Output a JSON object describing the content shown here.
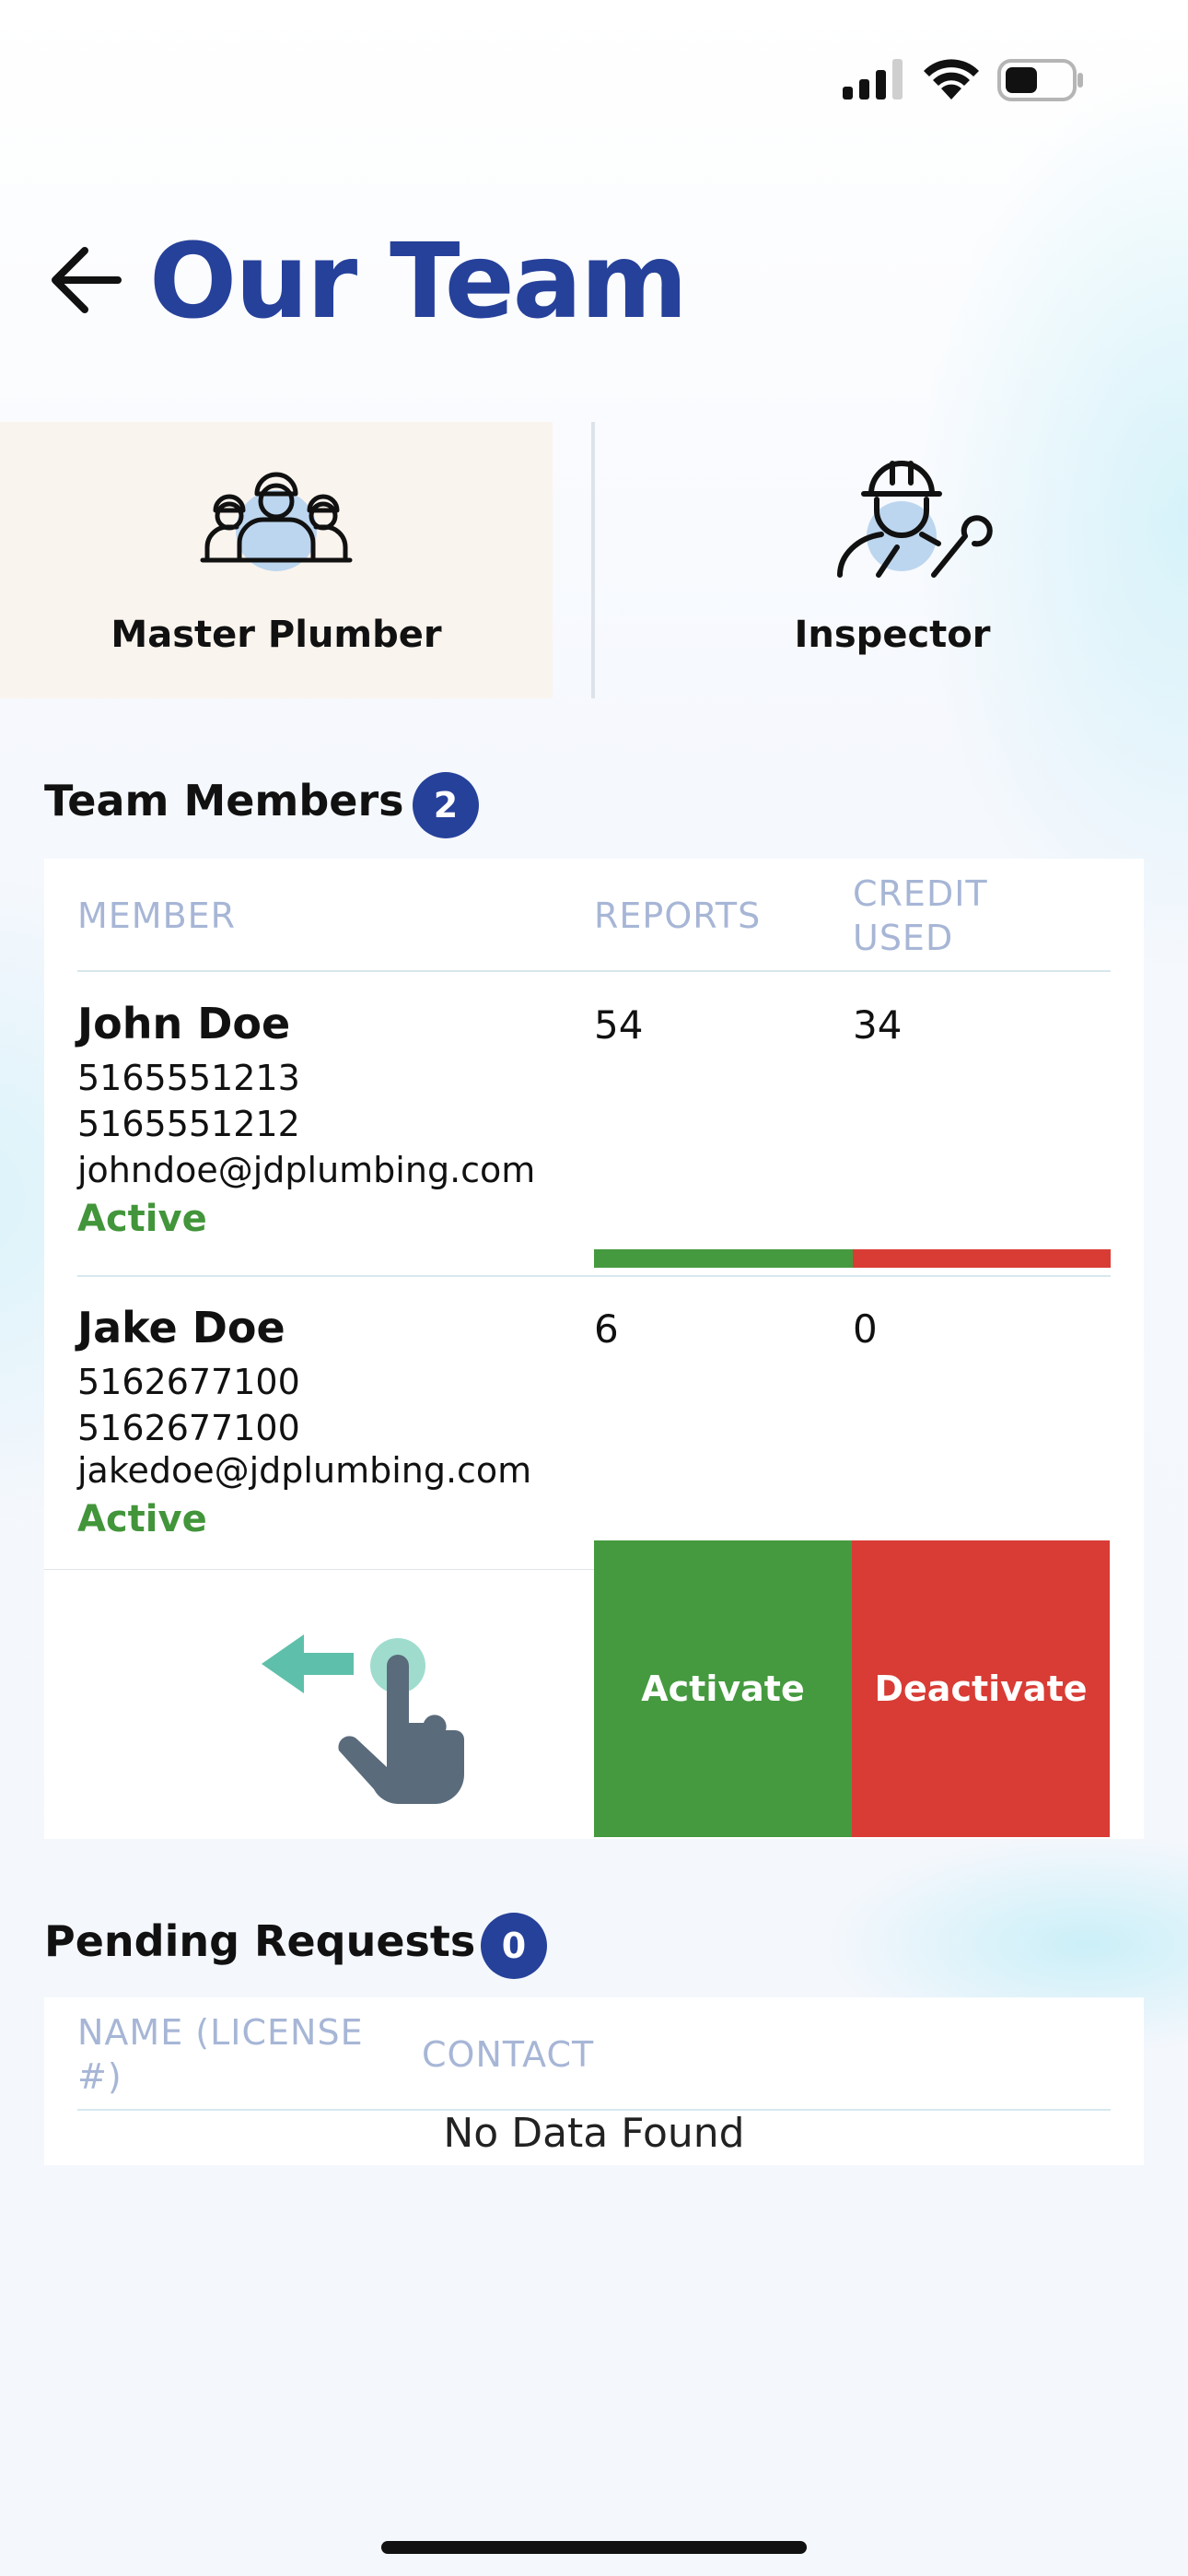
{
  "status_bar": {
    "battery_level": 0.5
  },
  "header": {
    "title": "Our Team",
    "back_icon": "arrow-left-icon"
  },
  "role_tabs": [
    {
      "label": "Master Plumber",
      "icon": "team-workers-icon",
      "selected": true
    },
    {
      "label": "Inspector",
      "icon": "worker-wrench-icon",
      "selected": false
    }
  ],
  "team_members": {
    "title": "Team Members",
    "count": "2",
    "columns": [
      "MEMBER",
      "REPORTS",
      "CREDIT",
      "USED"
    ],
    "rows": [
      {
        "name": "John Doe",
        "phone1": "5165551213",
        "phone2": "5165551212",
        "email": "johndoe@jdplumbing.com",
        "status": "Active",
        "reports": "54",
        "credit_used": "34"
      },
      {
        "name": "Jake Doe",
        "phone1": "5162677100",
        "phone2": "5162677100",
        "email": "jakedoe@jdplumbing.com",
        "status": "Active",
        "reports": "6",
        "credit_used": "0"
      }
    ],
    "actions": {
      "activate": "Activate",
      "deactivate": "Deactivate"
    },
    "swipe_hint_icon": "swipe-left-hand-icon"
  },
  "pending_requests": {
    "title": "Pending Requests",
    "count": "0",
    "columns": [
      "NAME (LICENSE",
      "#)",
      "CONTACT"
    ],
    "empty_text": "No Data Found"
  },
  "colors": {
    "brand": "#26419a",
    "active": "#42953a",
    "activate_bg": "#459a3f",
    "deactivate_bg": "#d83c35",
    "header_text": "#a7b6d6"
  }
}
